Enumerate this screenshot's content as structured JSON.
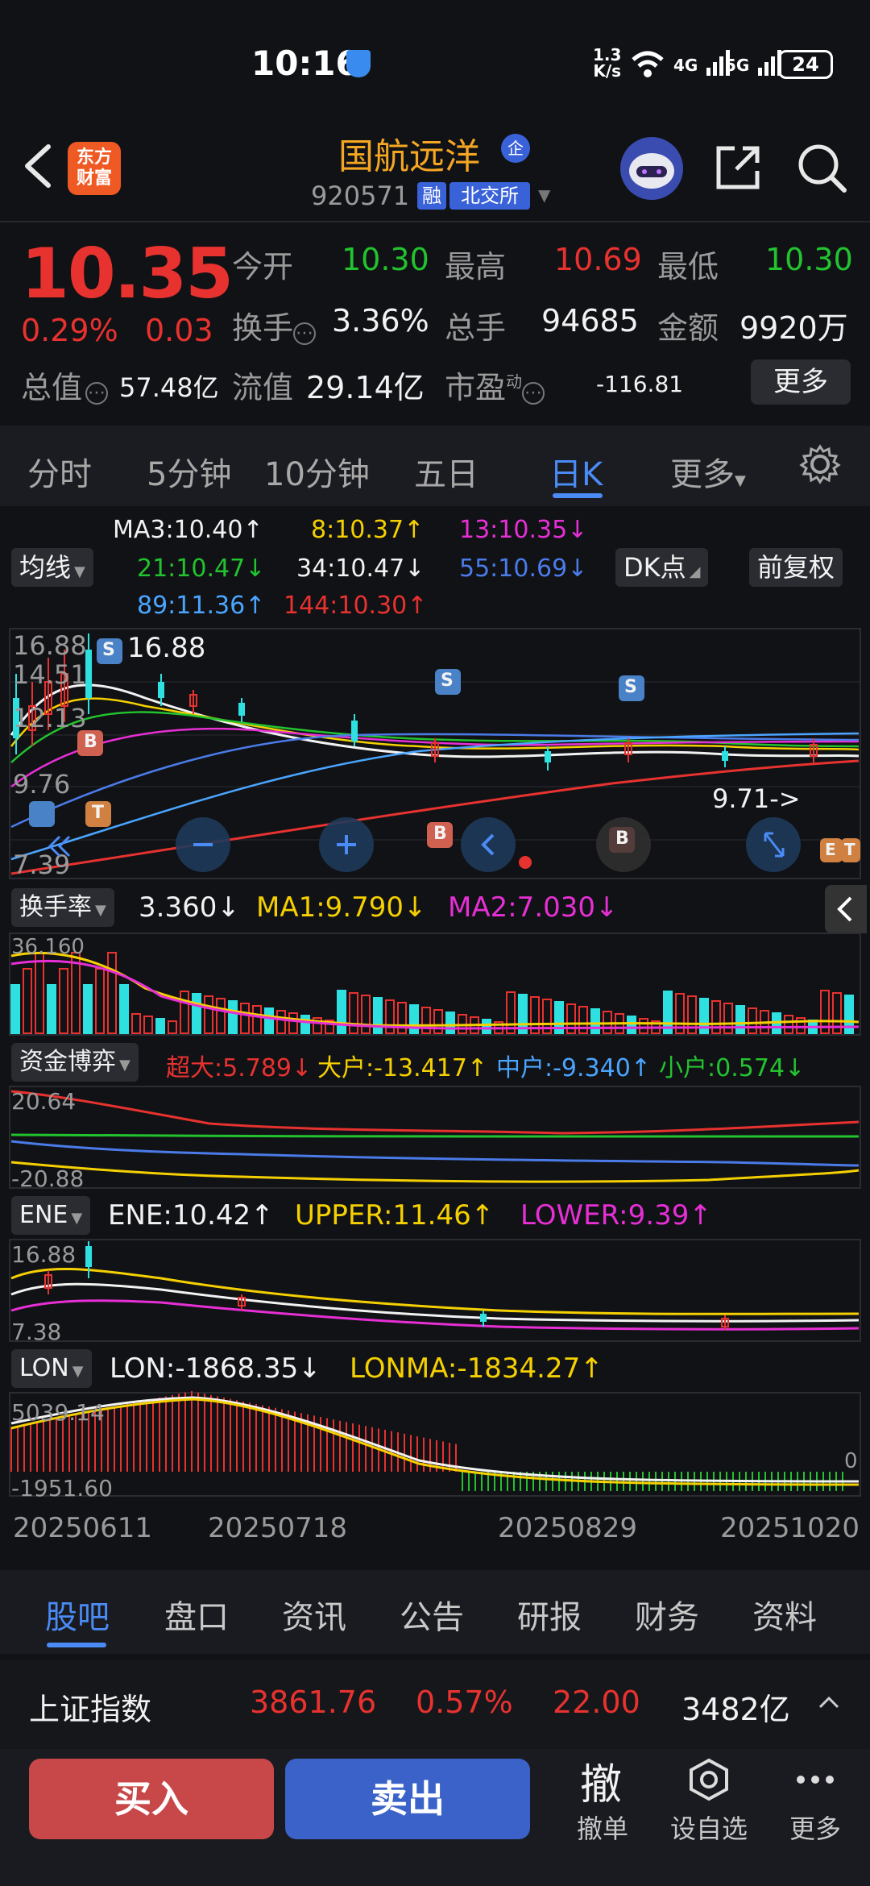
{
  "status_bar": {
    "time": "10:16",
    "net_speed_top": "1.3",
    "net_speed_bottom": "K/s",
    "wifi": "6",
    "sig1": "4G",
    "sig2": "5G",
    "battery": "24"
  },
  "header": {
    "logo_line1": "东方",
    "logo_line2": "财富",
    "stock_name": "国航远洋",
    "badge": "企",
    "code": "920571",
    "tag_rong": "融",
    "tag_exchange": "北交所"
  },
  "quote": {
    "price": "10.35",
    "change_pct": "0.29%",
    "change": "0.03",
    "open_label": "今开",
    "open": "10.30",
    "high_label": "最高",
    "high": "10.69",
    "low_label": "最低",
    "low": "10.30",
    "turnover_label": "换手",
    "turnover": "3.36%",
    "volume_label": "总手",
    "volume": "94685",
    "amount_label": "金额",
    "amount": "9920万",
    "cap_label": "总值",
    "cap": "57.48亿",
    "float_label": "流值",
    "float_cap": "29.14亿",
    "pe_label": "市盈",
    "pe_sup": "动",
    "pe": "-116.81",
    "more": "更多"
  },
  "period_tabs": [
    "分时",
    "5分钟",
    "10分钟",
    "五日",
    "日K",
    "更多",
    "⚙"
  ],
  "ma_legend": {
    "ma3": "MA3:10.40↑",
    "ma8": "8:10.37↑",
    "ma13": "13:10.35↓",
    "ma21": "21:10.47↓",
    "ma34": "34:10.47↓",
    "ma55": "55:10.69↓",
    "ma89": "89:11.36↑",
    "ma144": "144:10.30↑",
    "ma_button": "均线",
    "dk_button": "DK点",
    "adjust_button": "前复权"
  },
  "kline": {
    "y_labels": [
      "16.88",
      "14.51",
      "12.13",
      "9.76",
      "7.39"
    ],
    "max_marker": "16.88",
    "last_marker": "9.71->",
    "signals": [
      "S",
      "B",
      "T",
      "S",
      "S",
      "B",
      "B",
      "E",
      "T"
    ]
  },
  "turnover": {
    "button": "换手率",
    "value": "3.360↓",
    "ma1": "MA1:9.790↓",
    "ma2": "MA2:7.030↓",
    "y_max": "36.160"
  },
  "fund_flow": {
    "button": "资金博弈",
    "super": "超大:5.789↓",
    "large": "大户:-13.417↑",
    "medium": "中户:-9.340↑",
    "small": "小户:0.574↓",
    "y_max": "20.64",
    "y_min": "-20.88"
  },
  "ene": {
    "button": "ENE",
    "ene": "ENE:10.42↑",
    "upper": "UPPER:11.46↑",
    "lower": "LOWER:9.39↑",
    "y_max": "16.88",
    "y_min": "7.38"
  },
  "lon": {
    "button": "LON",
    "lon": "LON:-1868.35↓",
    "lonma": "LONMA:-1834.27↑",
    "y_max": "5039.14",
    "y_min": "-1951.60",
    "zero": "0"
  },
  "dates": [
    "20250611",
    "20250718",
    "20250829",
    "20251020"
  ],
  "bottom_tabs": [
    "股吧",
    "盘口",
    "资讯",
    "公告",
    "研报",
    "财务",
    "资料"
  ],
  "index_bar": {
    "name": "上证指数",
    "value": "3861.76",
    "pct": "0.57%",
    "change": "22.00",
    "amount": "3482亿"
  },
  "actions": {
    "buy": "买入",
    "sell": "卖出",
    "cancel_glyph": "撤",
    "cancel": "撤单",
    "watch": "设自选",
    "more": "更多"
  },
  "colors": {
    "up": "#e8322f",
    "down": "#22c32e",
    "accent": "#4a8bf5",
    "name": "#f5a623"
  }
}
